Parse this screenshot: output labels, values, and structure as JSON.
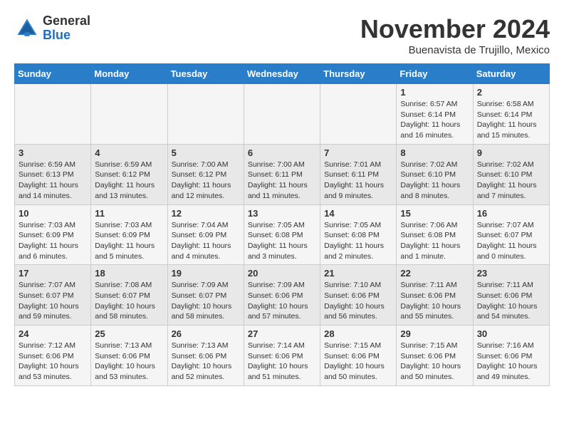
{
  "header": {
    "logo": {
      "general": "General",
      "blue": "Blue"
    },
    "title": "November 2024",
    "location": "Buenavista de Trujillo, Mexico"
  },
  "weekdays": [
    "Sunday",
    "Monday",
    "Tuesday",
    "Wednesday",
    "Thursday",
    "Friday",
    "Saturday"
  ],
  "weeks": [
    [
      {
        "day": "",
        "info": ""
      },
      {
        "day": "",
        "info": ""
      },
      {
        "day": "",
        "info": ""
      },
      {
        "day": "",
        "info": ""
      },
      {
        "day": "",
        "info": ""
      },
      {
        "day": "1",
        "info": "Sunrise: 6:57 AM\nSunset: 6:14 PM\nDaylight: 11 hours and 16 minutes."
      },
      {
        "day": "2",
        "info": "Sunrise: 6:58 AM\nSunset: 6:14 PM\nDaylight: 11 hours and 15 minutes."
      }
    ],
    [
      {
        "day": "3",
        "info": "Sunrise: 6:59 AM\nSunset: 6:13 PM\nDaylight: 11 hours and 14 minutes."
      },
      {
        "day": "4",
        "info": "Sunrise: 6:59 AM\nSunset: 6:12 PM\nDaylight: 11 hours and 13 minutes."
      },
      {
        "day": "5",
        "info": "Sunrise: 7:00 AM\nSunset: 6:12 PM\nDaylight: 11 hours and 12 minutes."
      },
      {
        "day": "6",
        "info": "Sunrise: 7:00 AM\nSunset: 6:11 PM\nDaylight: 11 hours and 11 minutes."
      },
      {
        "day": "7",
        "info": "Sunrise: 7:01 AM\nSunset: 6:11 PM\nDaylight: 11 hours and 9 minutes."
      },
      {
        "day": "8",
        "info": "Sunrise: 7:02 AM\nSunset: 6:10 PM\nDaylight: 11 hours and 8 minutes."
      },
      {
        "day": "9",
        "info": "Sunrise: 7:02 AM\nSunset: 6:10 PM\nDaylight: 11 hours and 7 minutes."
      }
    ],
    [
      {
        "day": "10",
        "info": "Sunrise: 7:03 AM\nSunset: 6:09 PM\nDaylight: 11 hours and 6 minutes."
      },
      {
        "day": "11",
        "info": "Sunrise: 7:03 AM\nSunset: 6:09 PM\nDaylight: 11 hours and 5 minutes."
      },
      {
        "day": "12",
        "info": "Sunrise: 7:04 AM\nSunset: 6:09 PM\nDaylight: 11 hours and 4 minutes."
      },
      {
        "day": "13",
        "info": "Sunrise: 7:05 AM\nSunset: 6:08 PM\nDaylight: 11 hours and 3 minutes."
      },
      {
        "day": "14",
        "info": "Sunrise: 7:05 AM\nSunset: 6:08 PM\nDaylight: 11 hours and 2 minutes."
      },
      {
        "day": "15",
        "info": "Sunrise: 7:06 AM\nSunset: 6:08 PM\nDaylight: 11 hours and 1 minute."
      },
      {
        "day": "16",
        "info": "Sunrise: 7:07 AM\nSunset: 6:07 PM\nDaylight: 11 hours and 0 minutes."
      }
    ],
    [
      {
        "day": "17",
        "info": "Sunrise: 7:07 AM\nSunset: 6:07 PM\nDaylight: 10 hours and 59 minutes."
      },
      {
        "day": "18",
        "info": "Sunrise: 7:08 AM\nSunset: 6:07 PM\nDaylight: 10 hours and 58 minutes."
      },
      {
        "day": "19",
        "info": "Sunrise: 7:09 AM\nSunset: 6:07 PM\nDaylight: 10 hours and 58 minutes."
      },
      {
        "day": "20",
        "info": "Sunrise: 7:09 AM\nSunset: 6:06 PM\nDaylight: 10 hours and 57 minutes."
      },
      {
        "day": "21",
        "info": "Sunrise: 7:10 AM\nSunset: 6:06 PM\nDaylight: 10 hours and 56 minutes."
      },
      {
        "day": "22",
        "info": "Sunrise: 7:11 AM\nSunset: 6:06 PM\nDaylight: 10 hours and 55 minutes."
      },
      {
        "day": "23",
        "info": "Sunrise: 7:11 AM\nSunset: 6:06 PM\nDaylight: 10 hours and 54 minutes."
      }
    ],
    [
      {
        "day": "24",
        "info": "Sunrise: 7:12 AM\nSunset: 6:06 PM\nDaylight: 10 hours and 53 minutes."
      },
      {
        "day": "25",
        "info": "Sunrise: 7:13 AM\nSunset: 6:06 PM\nDaylight: 10 hours and 53 minutes."
      },
      {
        "day": "26",
        "info": "Sunrise: 7:13 AM\nSunset: 6:06 PM\nDaylight: 10 hours and 52 minutes."
      },
      {
        "day": "27",
        "info": "Sunrise: 7:14 AM\nSunset: 6:06 PM\nDaylight: 10 hours and 51 minutes."
      },
      {
        "day": "28",
        "info": "Sunrise: 7:15 AM\nSunset: 6:06 PM\nDaylight: 10 hours and 50 minutes."
      },
      {
        "day": "29",
        "info": "Sunrise: 7:15 AM\nSunset: 6:06 PM\nDaylight: 10 hours and 50 minutes."
      },
      {
        "day": "30",
        "info": "Sunrise: 7:16 AM\nSunset: 6:06 PM\nDaylight: 10 hours and 49 minutes."
      }
    ]
  ]
}
